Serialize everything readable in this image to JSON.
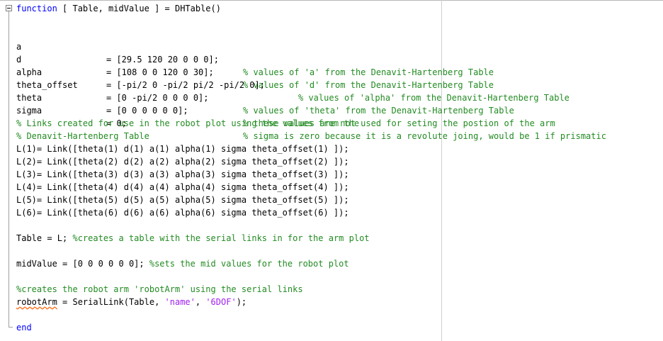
{
  "editor": {
    "lines": {
      "l1_kw": "function",
      "l1_rest": " [ Table, midValue ] = DHTable()",
      "a_name": "a",
      "a_val": "= [29.5 120 20 0 0 0];",
      "a_comment": "% values of 'a' from the Denavit-Hartenberg Table",
      "d_name": "d",
      "d_val": "= [108 0 0 120 0 30];",
      "d_comment": "% values of 'd' from the Denavit-Hartenberg Table",
      "alpha_name": "alpha",
      "alpha_val": "= [-pi/2 0 -pi/2 pi/2 -pi/2 0];",
      "alpha_comment": "% values of 'alpha' from the Denavit-Hartenberg Table",
      "theta_offset_name": "theta_offset",
      "theta_offset_val": "= [0 -pi/2 0 0 0 0];",
      "theta_offset_comment": "% values of 'theta' from the Denavit-Hartenberg Table",
      "theta_name": "theta",
      "theta_val": "= [0 0 0 0 0 0];",
      "theta_comment": "% these values are not used for seting the postion of the arm",
      "sigma_name": "sigma",
      "sigma_val": "= 0;",
      "sigma_comment": "% sigma is zero because it is a revolute joing, would be 1 if prismatic",
      "links_comment_1": "% Links created for use in the robot plot using the values from the",
      "links_comment_2": "% Denavit-Hartenberg Table",
      "link_1": "L(1)= Link([theta(1) d(1) a(1) alpha(1) sigma theta_offset(1) ]);",
      "link_2": "L(2)= Link([theta(2) d(2) a(2) alpha(2) sigma theta_offset(2) ]);",
      "link_3": "L(3)= Link([theta(3) d(3) a(3) alpha(3) sigma theta_offset(3) ]);",
      "link_4": "L(4)= Link([theta(4) d(4) a(4) alpha(4) sigma theta_offset(4) ]);",
      "link_5": "L(5)= Link([theta(5) d(5) a(5) alpha(5) sigma theta_offset(5) ]);",
      "link_6": "L(6)= Link([theta(6) d(6) a(6) alpha(6) sigma theta_offset(6) ]);",
      "table_code": "Table = L; ",
      "table_comment": "%creates a table with the serial links in for the arm plot",
      "mid_code": "midValue = [0 0 0 0 0 0]; ",
      "mid_comment": "%sets the mid values for the robot plot",
      "robot_comment": "%creates the robot arm 'robotArm' using the serial links",
      "robot_var": "robotArm",
      "robot_code": " = SerialLink(Table, ",
      "robot_str1": "'name'",
      "robot_sep": ", ",
      "robot_str2": "'6DOF'",
      "robot_end": ");",
      "end_kw": "end"
    },
    "colors": {
      "keyword": "#0000ff",
      "comment": "#228b22",
      "string": "#a020f0"
    }
  }
}
